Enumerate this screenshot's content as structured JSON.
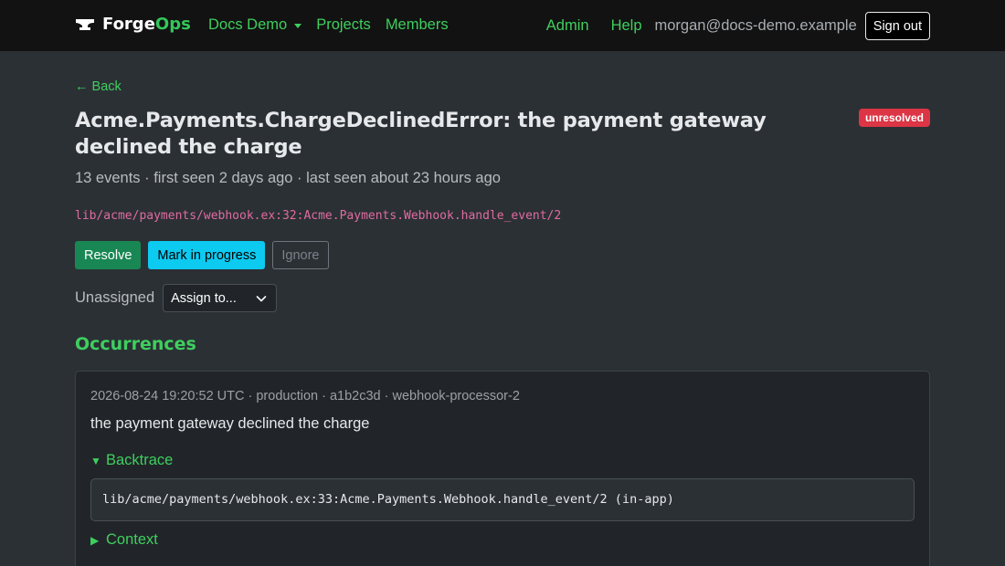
{
  "brand": {
    "name_part1": "Forge",
    "name_part2": "Ops"
  },
  "nav": {
    "project_dropdown": "Docs Demo",
    "projects": "Projects",
    "members": "Members",
    "admin": "Admin",
    "help": "Help",
    "user_email": "morgan@docs-demo.example",
    "sign_out": "Sign out"
  },
  "page": {
    "back": "← Back",
    "title": "Acme.Payments.ChargeDeclinedError: the payment gateway declined the charge",
    "status": "unresolved",
    "meta": "13 events · first seen 2 days ago · last seen about 23 hours ago",
    "culprit": "lib/acme/payments/webhook.ex:32:Acme.Payments.Webhook.handle_event/2"
  },
  "actions": {
    "resolve": "Resolve",
    "mark_in_progress": "Mark in progress",
    "ignore": "Ignore"
  },
  "assignment": {
    "label": "Unassigned",
    "select_value": "Assign to..."
  },
  "occurrences": {
    "title": "Occurrences",
    "items": [
      {
        "meta": "2026-08-24 19:20:52 UTC · production · a1b2c3d · webhook-processor-2",
        "message": "the payment gateway declined the charge",
        "backtrace_label": "Backtrace",
        "backtrace_line": "lib/acme/payments/webhook.ex:33:Acme.Payments.Webhook.handle_event/2 (in-app)",
        "context_label": "Context"
      }
    ]
  },
  "colors": {
    "accent": "#3ecf5e",
    "danger": "#dc3545",
    "success": "#198754",
    "info": "#0dcaf0",
    "culprit": "#e06c9f"
  }
}
